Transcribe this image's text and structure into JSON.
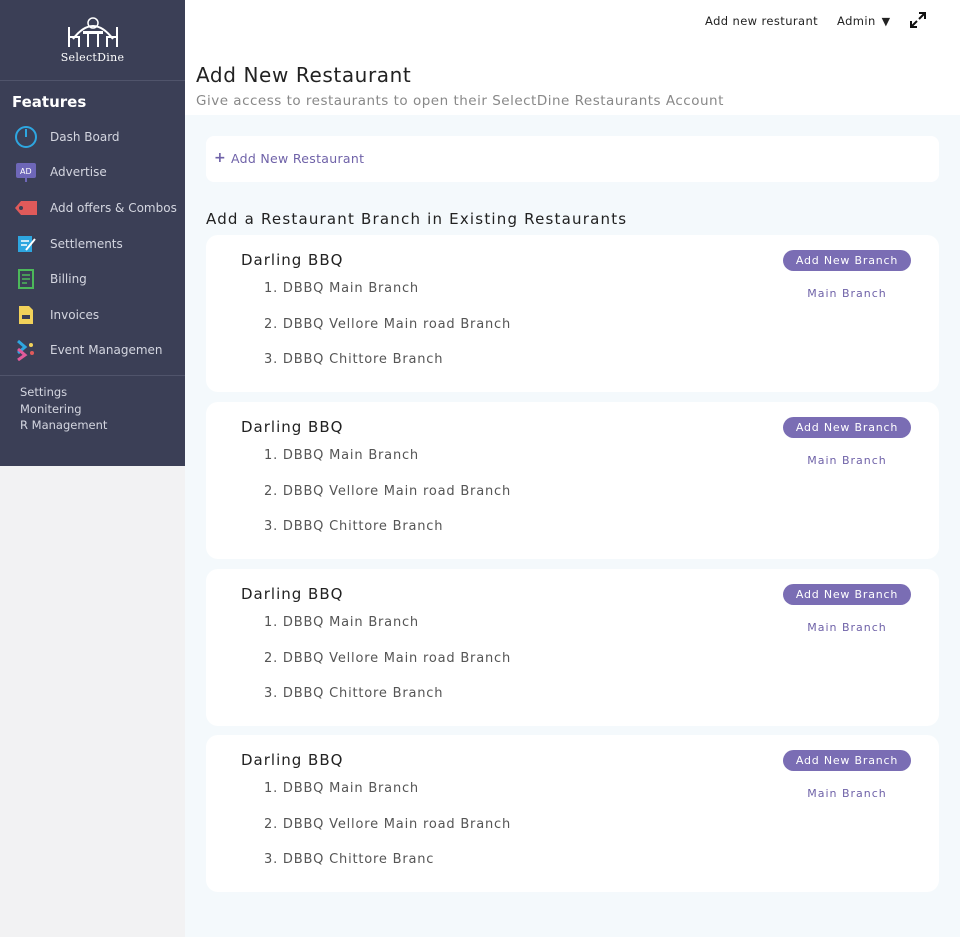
{
  "app": {
    "logo_text": "SelectDine"
  },
  "sidebar": {
    "title": "Features",
    "items": [
      {
        "label": "Dash Board",
        "icon": "dashboard-icon"
      },
      {
        "label": "Advertise",
        "icon": "ad-icon"
      },
      {
        "label": "Add offers & Combos",
        "icon": "offer-tag-icon"
      },
      {
        "label": "Settlements",
        "icon": "settlement-icon"
      },
      {
        "label": "Billing",
        "icon": "billing-icon"
      },
      {
        "label": "Invoices",
        "icon": "invoice-icon"
      },
      {
        "label": "Event Managemen",
        "icon": "event-icon"
      }
    ],
    "links": [
      "Settings",
      "Monitering",
      "R Management"
    ]
  },
  "topbar": {
    "add_label": "Add new resturant",
    "admin_label": "Admin",
    "admin_caret": "▼"
  },
  "header": {
    "title": "Add New Restaurant",
    "subtitle": "Give access to restaurants to open their SelectDine Restaurants Account"
  },
  "add_new": {
    "plus": "+",
    "label": "Add New Restaurant"
  },
  "section_title": "Add a Restaurant Branch in Existing Restaurants",
  "restaurants": [
    {
      "name": "Darling BBQ",
      "add_branch_label": "Add New Branch",
      "main_branch_label": "Main Branch",
      "branches": [
        "1. DBBQ Main Branch",
        "2. DBBQ Vellore Main road Branch",
        "3. DBBQ Chittore Branch"
      ]
    },
    {
      "name": "Darling BBQ",
      "add_branch_label": "Add New Branch",
      "main_branch_label": "Main Branch",
      "branches": [
        "1. DBBQ Main Branch",
        "2. DBBQ Vellore Main road Branch",
        "3. DBBQ Chittore Branch"
      ]
    },
    {
      "name": "Darling BBQ",
      "add_branch_label": "Add New Branch",
      "main_branch_label": "Main Branch",
      "branches": [
        "1. DBBQ Main Branch",
        "2. DBBQ Vellore Main road Branch",
        "3. DBBQ Chittore Branch"
      ]
    },
    {
      "name": "Darling BBQ",
      "add_branch_label": "Add New Branch",
      "main_branch_label": "Main Branch",
      "branches": [
        "1. DBBQ Main Branch",
        "2. DBBQ Vellore Main road Branch",
        "3. DBBQ Chittore Branc"
      ]
    }
  ],
  "colors": {
    "sidebar_bg": "#3b3f56",
    "accent": "#7a6db4",
    "main_bg": "#f4f9fc"
  }
}
